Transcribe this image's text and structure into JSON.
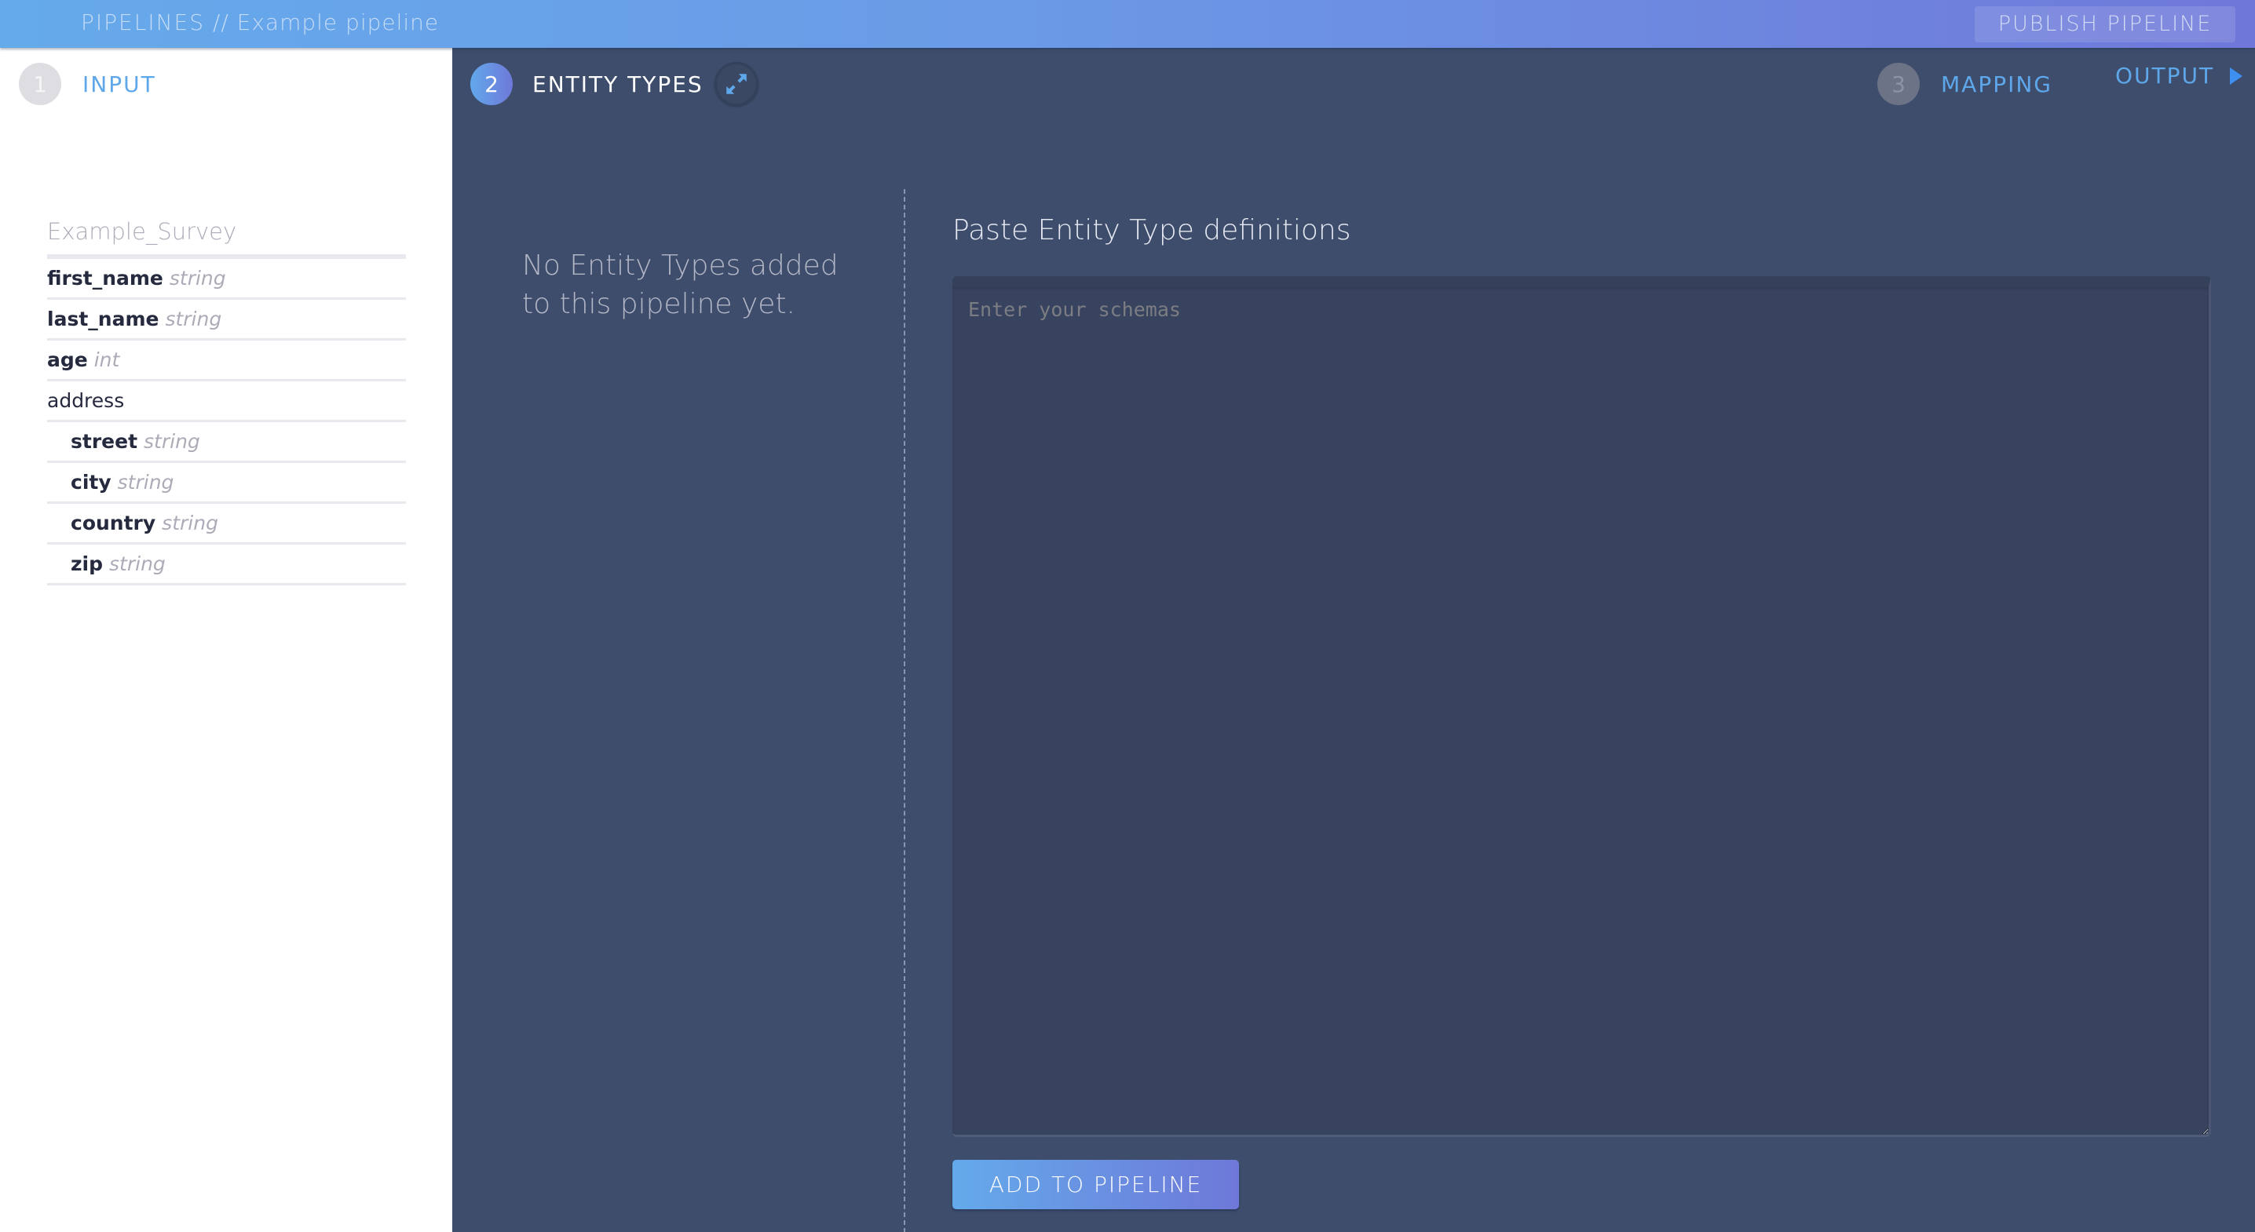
{
  "header": {
    "breadcrumb_root": "PIPELINES",
    "breadcrumb_separator": " // ",
    "breadcrumb_current": "Example pipeline",
    "publish_label": "PUBLISH PIPELINE"
  },
  "steps": [
    {
      "number": "1",
      "label": "INPUT",
      "state": "completed"
    },
    {
      "number": "2",
      "label": "ENTITY TYPES",
      "state": "active"
    },
    {
      "number": "3",
      "label": "MAPPING",
      "state": "pending"
    },
    {
      "number": "",
      "label": "OUTPUT",
      "state": "pending"
    }
  ],
  "icons": {
    "expand": "expand-arrows-icon",
    "output_arrow": "play-triangle-icon"
  },
  "input_schema": {
    "title": "Example_Survey",
    "fields": [
      {
        "name": "first_name",
        "type": "string",
        "level": 0
      },
      {
        "name": "last_name",
        "type": "string",
        "level": 0
      },
      {
        "name": "age",
        "type": "int",
        "level": 0
      },
      {
        "name": "address",
        "type": "",
        "level": 0
      },
      {
        "name": "street",
        "type": "string",
        "level": 1
      },
      {
        "name": "city",
        "type": "string",
        "level": 1
      },
      {
        "name": "country",
        "type": "string",
        "level": 1
      },
      {
        "name": "zip",
        "type": "string",
        "level": 1
      }
    ]
  },
  "entity_types": {
    "empty_message": "No Entity Types added to this pipeline yet.",
    "paste_title": "Paste Entity Type definitions",
    "textarea_value": "",
    "textarea_placeholder": "Enter your schemas",
    "add_label": "ADD TO PIPELINE"
  },
  "colors": {
    "accent_start": "#65aaeb",
    "accent_end": "#6e78d8",
    "panel_dark": "#3d4d6b",
    "link_blue": "#5ea7ea"
  }
}
